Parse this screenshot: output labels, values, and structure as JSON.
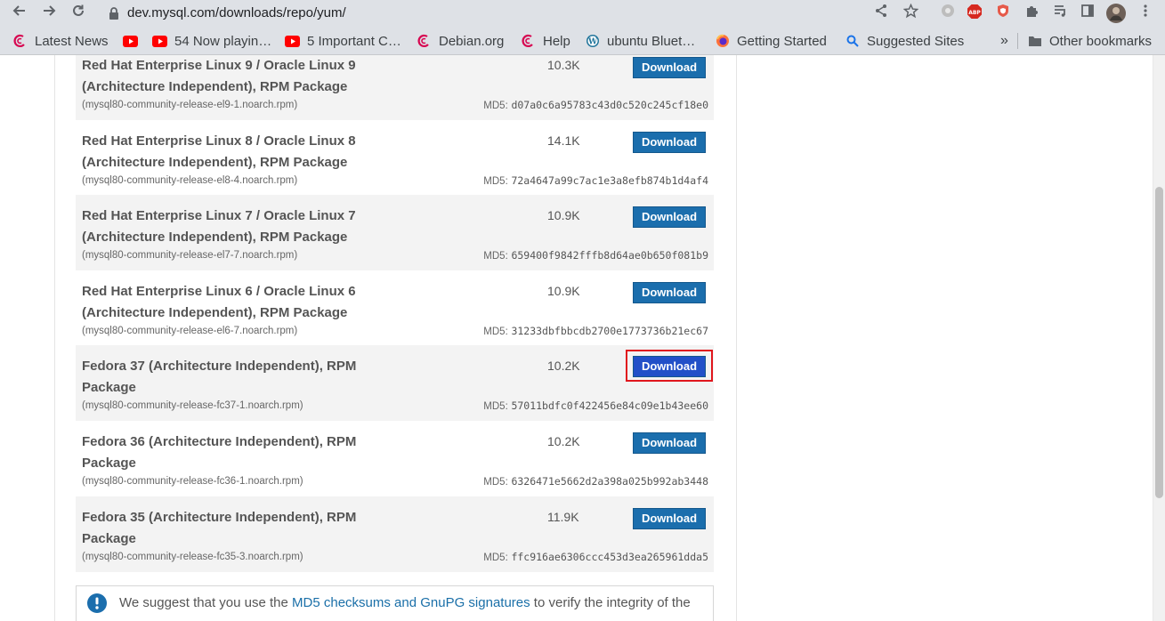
{
  "browser": {
    "url": "dev.mysql.com/downloads/repo/yum/",
    "bookmarks": [
      {
        "label": "Latest News",
        "icon": "debian-icon"
      },
      {
        "label": "",
        "icon": "youtube-icon"
      },
      {
        "label": "54 Now playin…",
        "icon": "youtube-icon"
      },
      {
        "label": "5 Important C…",
        "icon": "youtube-icon"
      },
      {
        "label": "Debian.org",
        "icon": "debian-icon"
      },
      {
        "label": "Help",
        "icon": "debian-icon"
      },
      {
        "label": "ubuntu Bluet…",
        "icon": "wordpress-icon"
      },
      {
        "label": "Getting Started",
        "icon": "firefox-icon"
      },
      {
        "label": "Suggested Sites",
        "icon": "search-icon"
      }
    ],
    "overflow": "»",
    "other_bookmarks": "Other bookmarks",
    "toolbar_icons": [
      "share-icon",
      "star-icon",
      "extension-gray-icon",
      "abp-icon",
      "shield-icon",
      "puzzle-icon",
      "media-queue-icon",
      "sidepanel-icon",
      "avatar",
      "menu-icon"
    ]
  },
  "downloads": [
    {
      "title": "Red Hat Enterprise Linux 9 / Oracle Linux 9 (Architecture Independent), RPM Package",
      "size": "10.3K",
      "button": "Download",
      "file": "(mysql80-community-release-el9-1.noarch.rpm)",
      "md5_label": "MD5:",
      "md5": "d07a0c6a95783c43d0c520c245cf18e0"
    },
    {
      "title": "Red Hat Enterprise Linux 8 / Oracle Linux 8 (Architecture Independent), RPM Package",
      "size": "14.1K",
      "button": "Download",
      "file": "(mysql80-community-release-el8-4.noarch.rpm)",
      "md5_label": "MD5:",
      "md5": "72a4647a99c7ac1e3a8efb874b1d4af4"
    },
    {
      "title": "Red Hat Enterprise Linux 7 / Oracle Linux 7 (Architecture Independent), RPM Package",
      "size": "10.9K",
      "button": "Download",
      "file": "(mysql80-community-release-el7-7.noarch.rpm)",
      "md5_label": "MD5:",
      "md5": "659400f9842fffb8d64ae0b650f081b9"
    },
    {
      "title": "Red Hat Enterprise Linux 6 / Oracle Linux 6 (Architecture Independent), RPM Package",
      "size": "10.9K",
      "button": "Download",
      "file": "(mysql80-community-release-el6-7.noarch.rpm)",
      "md5_label": "MD5:",
      "md5": "31233dbfbbcdb2700e1773736b21ec67"
    },
    {
      "title": "Fedora 37 (Architecture Independent), RPM Package",
      "size": "10.2K",
      "button": "Download",
      "file": "(mysql80-community-release-fc37-1.noarch.rpm)",
      "md5_label": "MD5:",
      "md5": "57011bdfc0f422456e84c09e1b43ee60"
    },
    {
      "title": "Fedora 36 (Architecture Independent), RPM Package",
      "size": "10.2K",
      "button": "Download",
      "file": "(mysql80-community-release-fc36-1.noarch.rpm)",
      "md5_label": "MD5:",
      "md5": "6326471e5662d2a398a025b992ab3448"
    },
    {
      "title": "Fedora 35 (Architecture Independent), RPM Package",
      "size": "11.9K",
      "button": "Download",
      "file": "(mysql80-community-release-fc35-3.noarch.rpm)",
      "md5_label": "MD5:",
      "md5": "ffc916ae6306ccc453d3ea265961dda5"
    }
  ],
  "notice": {
    "before": "We suggest that you use the ",
    "link": "MD5 checksums and GnuPG signatures",
    "after": " to verify the integrity of the"
  },
  "colors": {
    "download_button": "#1b6ead",
    "download_active": "#2250c8",
    "highlight_frame": "#e0161d",
    "row_shade": "#f3f3f3"
  }
}
